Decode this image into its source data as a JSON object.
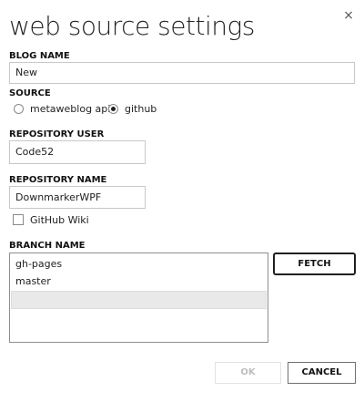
{
  "dialog": {
    "title": "web source settings",
    "close_glyph": "×"
  },
  "blog_name": {
    "label": "BLOG NAME",
    "value": "New"
  },
  "source": {
    "label": "SOURCE",
    "options": [
      {
        "label": "metaweblog api",
        "selected": false
      },
      {
        "label": "github",
        "selected": true
      }
    ]
  },
  "repository_user": {
    "label": "REPOSITORY USER",
    "value": "Code52"
  },
  "repository_name": {
    "label": "REPOSITORY NAME",
    "value": "DownmarkerWPF"
  },
  "github_wiki": {
    "label": "GitHub Wiki",
    "checked": false
  },
  "branch": {
    "label": "BRANCH NAME",
    "items": [
      "gh-pages",
      "master"
    ],
    "fetch_label": "FETCH"
  },
  "footer": {
    "ok_label": "OK",
    "ok_enabled": false,
    "cancel_label": "CANCEL"
  }
}
